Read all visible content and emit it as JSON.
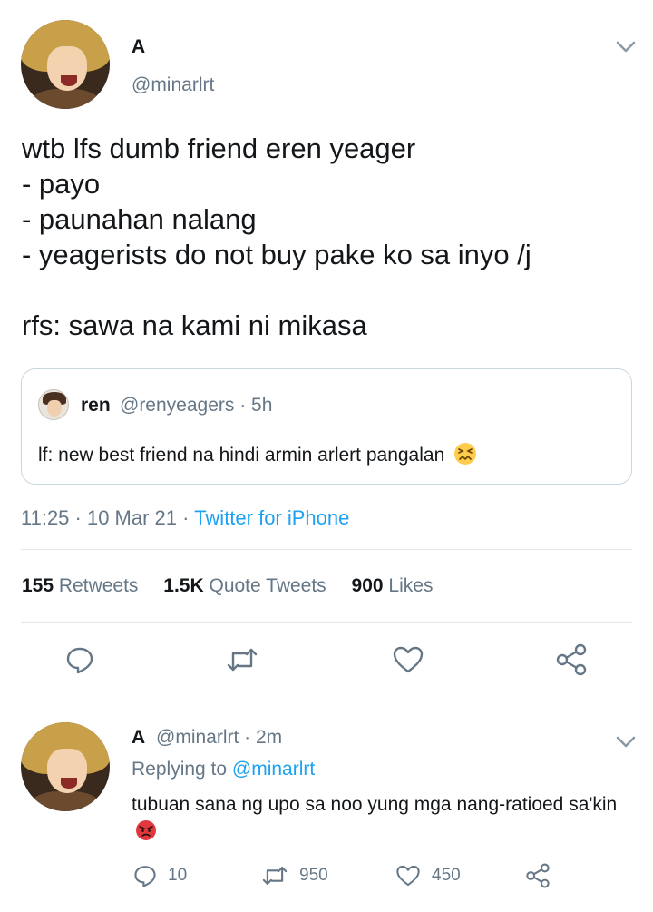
{
  "tweet": {
    "author_name": "A",
    "author_handle": "@minarlrt",
    "text": "wtb lfs dumb friend eren yeager\n- payo\n- paunahan nalang\n- yeagerists do not buy pake ko sa inyo /j\n\nrfs: sawa na kami ni mikasa",
    "quoted": {
      "author_name": "ren",
      "author_handle": "@renyeagers · 5h",
      "text": "lf: new best friend na hindi armin arlert pangalan"
    },
    "time": "11:25 · 10 Mar 21 · ",
    "client": "Twitter for iPhone",
    "stats": {
      "retweets_count": "155",
      "retweets_label": "Retweets",
      "quotes_count": "1.5K",
      "quotes_label": "Quote Tweets",
      "likes_count": "900",
      "likes_label": "Likes"
    },
    "icons": [
      "reply-icon",
      "retweet-icon",
      "like-icon",
      "share-icon"
    ]
  },
  "reply": {
    "author_name": "A",
    "author_handle": "@minarlrt · 2m",
    "replying_prefix": "Replying to",
    "replying_to": "@minarlrt",
    "text": "tubuan sana ng upo sa noo yung mga nang-ratioed sa'kin",
    "reply_count": "10",
    "retweet_count": "950",
    "like_count": "450"
  },
  "colors": {
    "accent": "#1da1f2",
    "muted": "#657786",
    "divider": "#e1e8ed",
    "text": "#14171a"
  }
}
